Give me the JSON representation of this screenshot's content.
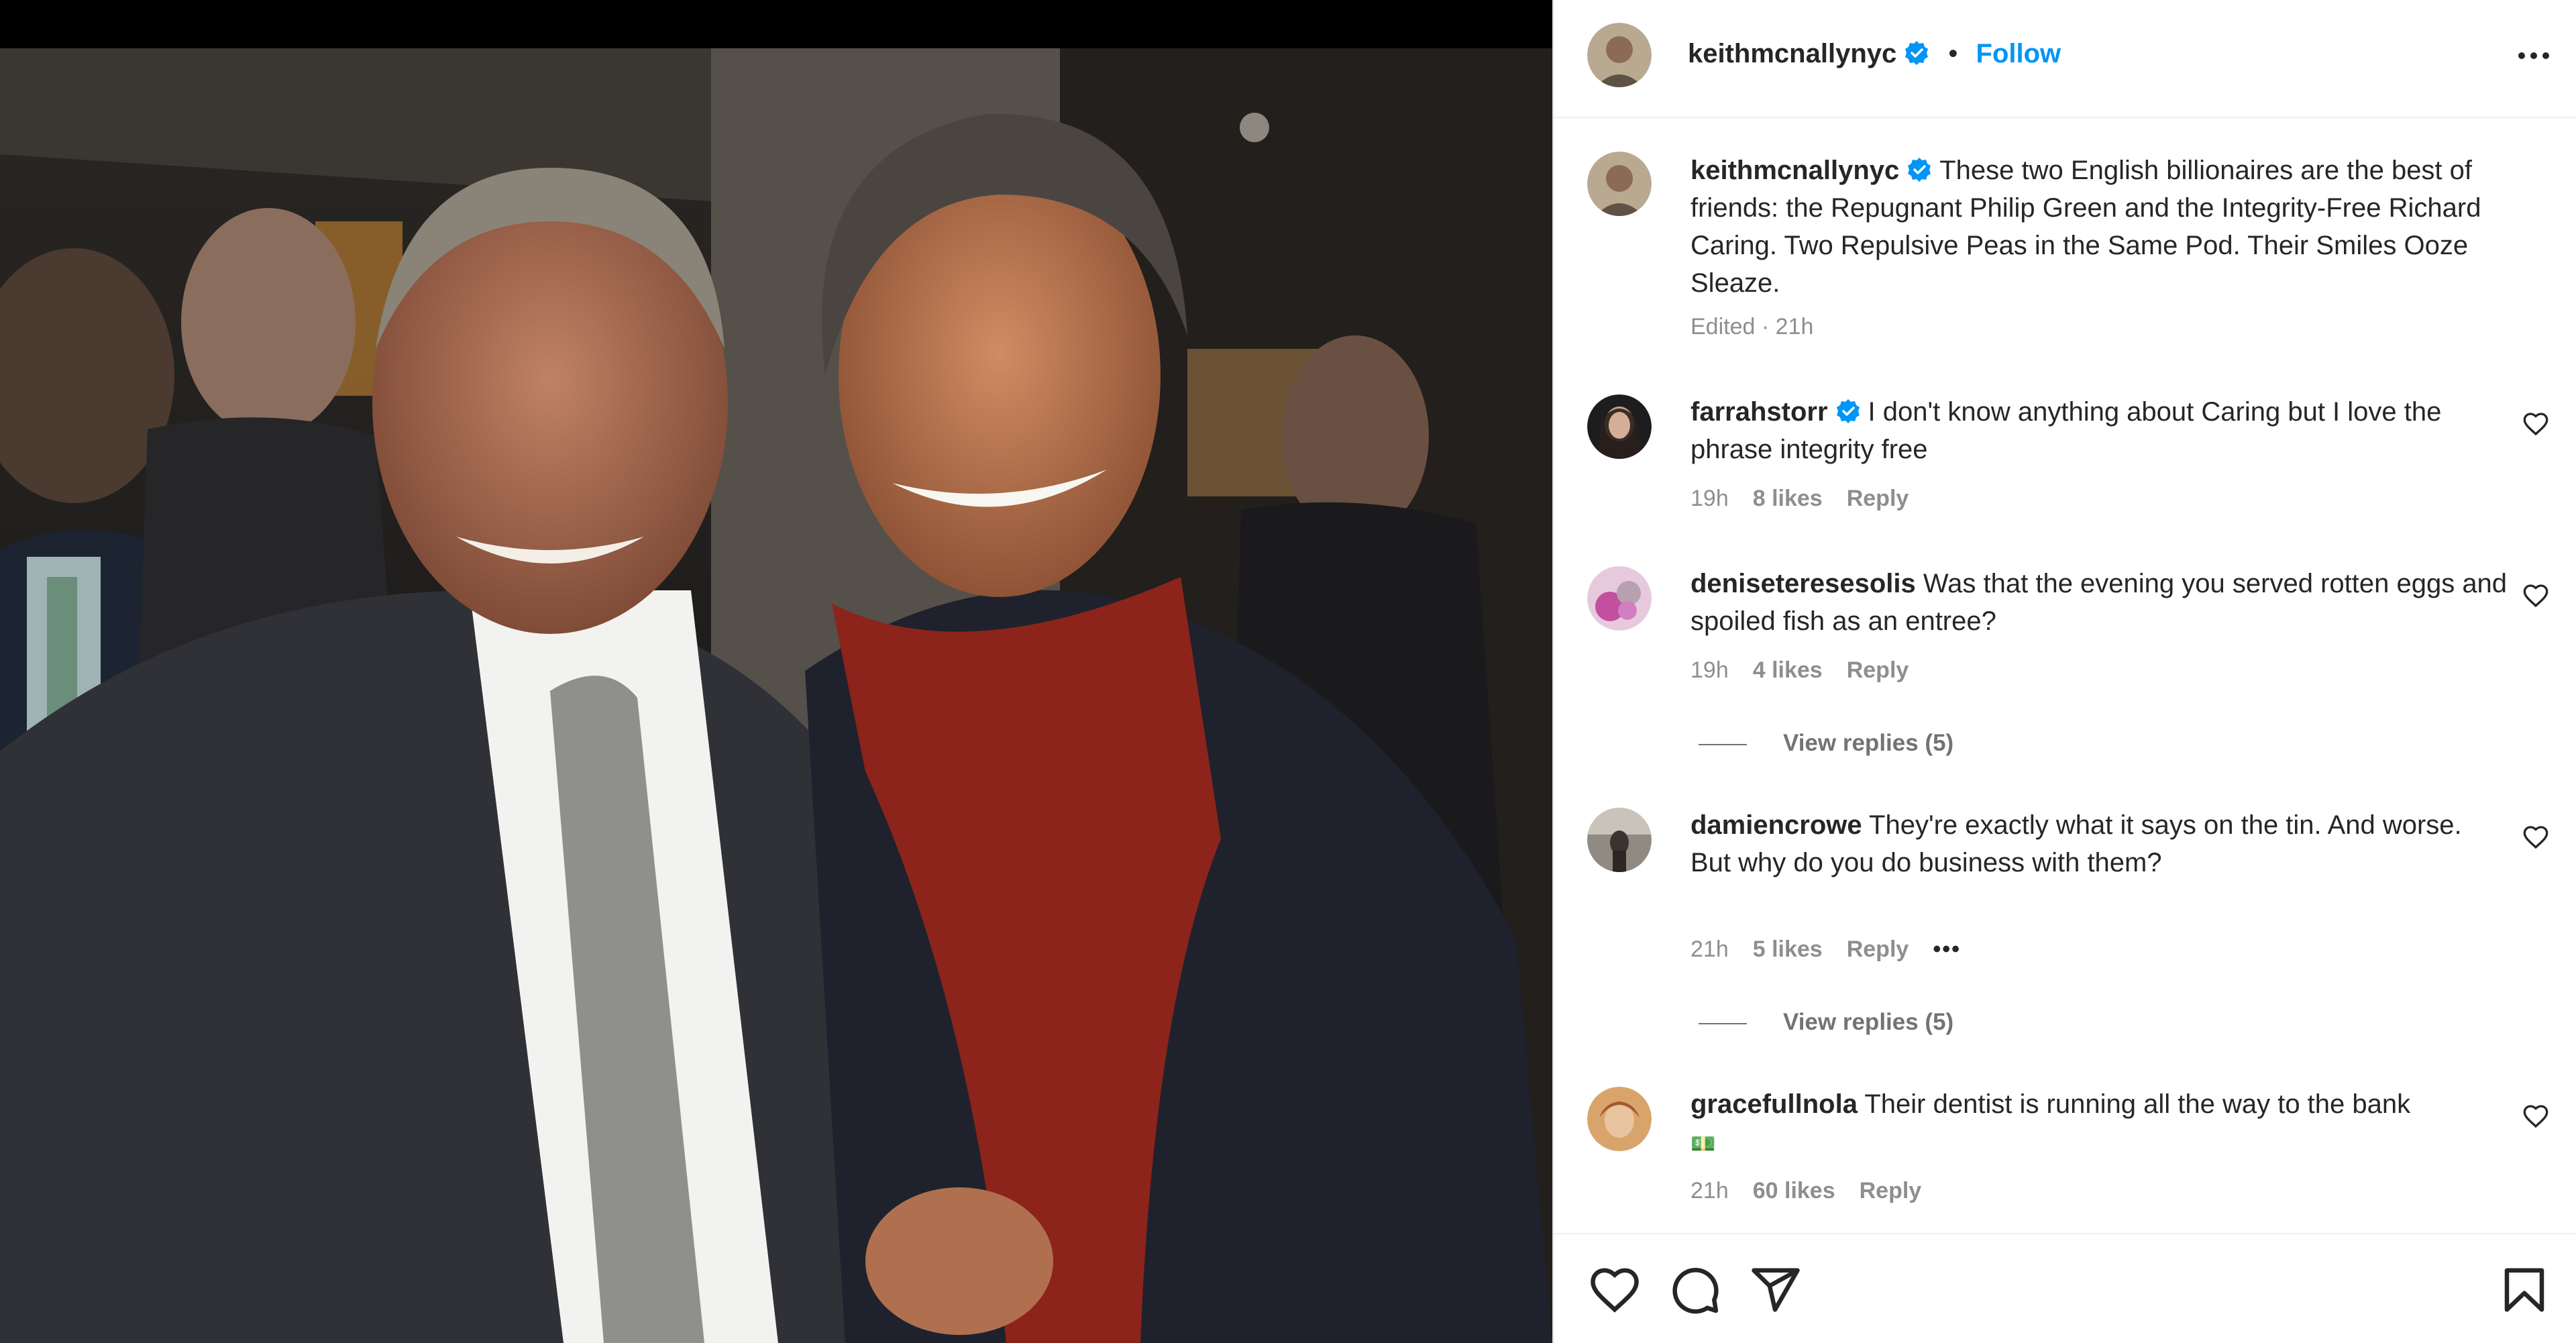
{
  "post": {
    "author": "keithmcnallynyc",
    "follow_label": "Follow",
    "separator": "•",
    "caption": "These two English billionaires are the best of friends: the Repugnant Philip Green and the Integrity-Free Richard Caring. Two Repulsive Peas in the Same Pod. Their Smiles Ooze Sleaze.",
    "caption_meta": "Edited · 21h"
  },
  "comments": [
    {
      "user": "farrahstorr",
      "verified": true,
      "text": "I don't know anything about Caring but I love the phrase integrity free",
      "time": "19h",
      "likes": "8 likes",
      "reply": "Reply"
    },
    {
      "user": "deniseteresesolis",
      "verified": false,
      "text": "Was that the evening you served rotten eggs and spoiled fish as an entree?",
      "time": "19h",
      "likes": "4 likes",
      "reply": "Reply",
      "view_replies": "View replies (5)"
    },
    {
      "user": "damiencrowe",
      "verified": false,
      "text": "They're exactly what it says on the tin. And worse.",
      "text2": "But why do you do business with them?",
      "time": "21h",
      "likes": "5 likes",
      "reply": "Reply",
      "more": "•••",
      "view_replies": "View replies (5)"
    },
    {
      "user": "gracefullnola",
      "verified": false,
      "text": "Their dentist is running all the way to the bank",
      "emoji": "💵",
      "time": "21h",
      "likes": "60 likes",
      "reply": "Reply"
    }
  ],
  "icons": {
    "more": "more-options-icon",
    "like": "heart-icon",
    "comment": "comment-icon",
    "share": "share-icon",
    "save": "bookmark-icon",
    "verified": "verified-badge-icon"
  },
  "colors": {
    "link_blue": "#0095f6",
    "verified_blue": "#0095f6",
    "muted": "#8e8e8e"
  }
}
